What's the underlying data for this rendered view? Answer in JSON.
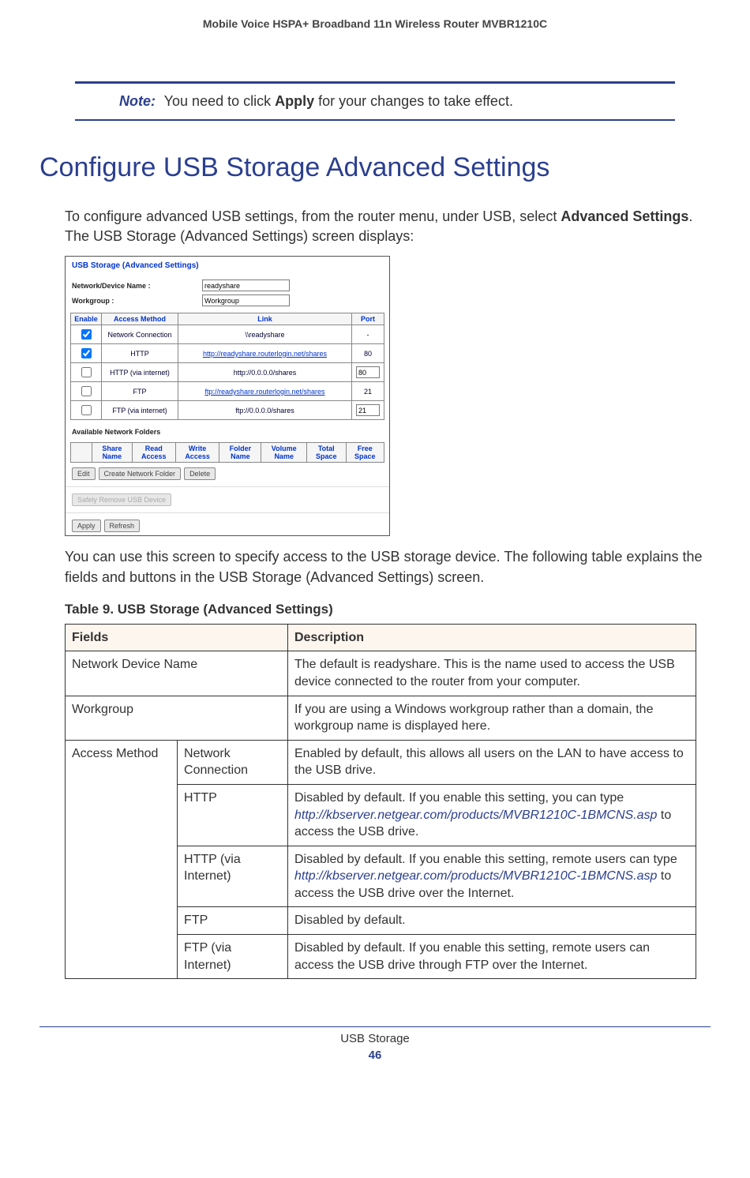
{
  "header": {
    "doc_title": "Mobile Voice HSPA+ Broadband 11n Wireless Router MVBR1210C"
  },
  "note": {
    "label": "Note:",
    "text_before_bold": " You need to click ",
    "bold_word": "Apply",
    "text_after_bold": " for your changes to take effect."
  },
  "section": {
    "title": "Configure USB Storage Advanced Settings",
    "intro_before_bold": "To configure advanced USB settings, from the router menu, under USB, select ",
    "intro_bold": "Advanced Settings",
    "intro_after_bold": ". The USB Storage (Advanced Settings) screen displays:",
    "after_img": "You can use this screen to specify access to the USB storage device. The following table explains the fields and buttons in the USB Storage (Advanced Settings) screen."
  },
  "screenshot": {
    "title": "USB Storage (Advanced Settings)",
    "net_device_label": "Network/Device Name :",
    "net_device_value": "readyshare",
    "workgroup_label": "Workgroup :",
    "workgroup_value": "Workgroup",
    "tbl_h_enable": "Enable",
    "tbl_h_access": "Access Method",
    "tbl_h_link": "Link",
    "tbl_h_port": "Port",
    "rows": [
      {
        "checked": true,
        "method": "Network Connection",
        "link": "\\\\readyshare",
        "link_is_url": false,
        "port": "-",
        "port_editable": false
      },
      {
        "checked": true,
        "method": "HTTP",
        "link": "http://readyshare.routerlogin.net/shares",
        "link_is_url": true,
        "port": "80",
        "port_editable": false
      },
      {
        "checked": false,
        "method": "HTTP (via internet)",
        "link": "http://0.0.0.0/shares",
        "link_is_url": false,
        "port": "80",
        "port_editable": true
      },
      {
        "checked": false,
        "method": "FTP",
        "link": "ftp://readyshare.routerlogin.net/shares",
        "link_is_url": true,
        "port": "21",
        "port_editable": false
      },
      {
        "checked": false,
        "method": "FTP (via internet)",
        "link": "ftp://0.0.0.0/shares",
        "link_is_url": false,
        "port": "21",
        "port_editable": true
      }
    ],
    "avail_hdr": "Available Network Folders",
    "folder_cols": [
      "",
      "Share Name",
      "Read Access",
      "Write Access",
      "Folder Name",
      "Volume Name",
      "Total Space",
      "Free Space"
    ],
    "btn_edit": "Edit",
    "btn_create": "Create Network Folder",
    "btn_delete": "Delete",
    "btn_remove": "Safely Remove USB Device",
    "btn_apply": "Apply",
    "btn_refresh": "Refresh"
  },
  "table": {
    "caption": "Table 9.  USB Storage (Advanced Settings) ",
    "h_fields": "Fields",
    "h_desc": "Description",
    "row_network_device": {
      "field": "Network Device Name",
      "desc": "The default is readyshare. This is the name used to access the USB device connected to the router from your computer."
    },
    "row_workgroup": {
      "field": "Workgroup",
      "desc": "If you are using a Windows workgroup rather than a domain, the workgroup name is displayed here."
    },
    "access_method_label": "Access Method",
    "access_rows": {
      "netconn": {
        "label": "Network Connection",
        "desc": "Enabled by default, this allows all users on the LAN to have access to the USB drive."
      },
      "http": {
        "label": "HTTP",
        "desc_pre": "Disabled by default. If you enable this setting, you can type ",
        "url": "http://kbserver.netgear.com/products/MVBR1210C-1BMCNS.asp",
        "desc_post": " to access the USB drive."
      },
      "http_via": {
        "label": "HTTP (via Internet)",
        "desc_pre": "Disabled by default. If you enable this setting, remote users can type ",
        "url": "http://kbserver.netgear.com/products/MVBR1210C-1BMCNS.asp",
        "desc_post": " to access the USB drive over the Internet."
      },
      "ftp": {
        "label": "FTP",
        "desc": "Disabled by default."
      },
      "ftp_via": {
        "label": "FTP (via Internet)",
        "desc": "Disabled by default. If you enable this setting, remote users can access the USB drive through FTP over the Internet."
      }
    }
  },
  "footer": {
    "section": "USB Storage",
    "page": "46"
  }
}
